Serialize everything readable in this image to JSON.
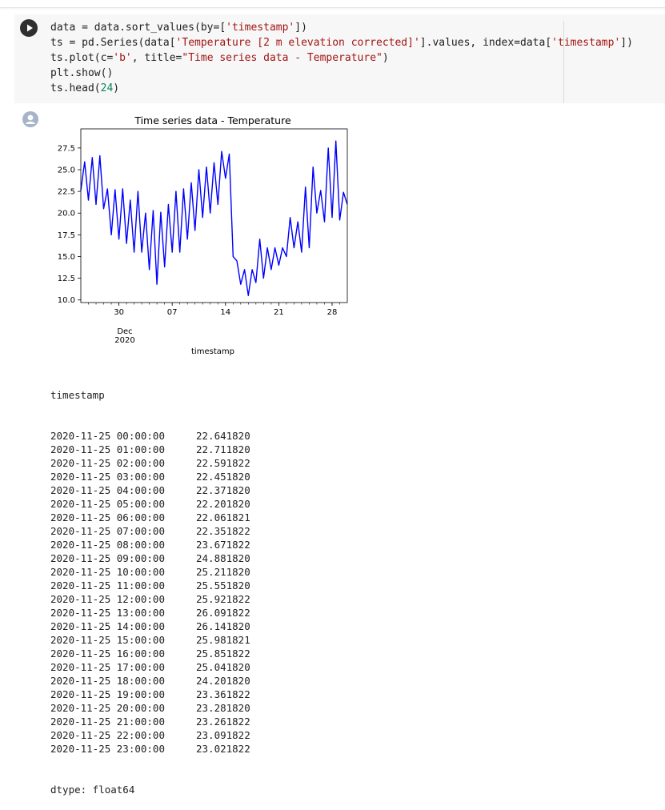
{
  "code_cell": {
    "lines": [
      [
        {
          "t": "data = data.sort_values(by=["
        },
        {
          "t": "'timestamp'",
          "c": "str"
        },
        {
          "t": "])"
        }
      ],
      [
        {
          "t": "ts = pd.Series(data["
        },
        {
          "t": "'Temperature [2 m elevation corrected]'",
          "c": "str"
        },
        {
          "t": "].values, index=data["
        },
        {
          "t": "'timestamp'",
          "c": "str"
        },
        {
          "t": "])"
        }
      ],
      [
        {
          "t": "ts.plot(c="
        },
        {
          "t": "'b'",
          "c": "str"
        },
        {
          "t": ", title="
        },
        {
          "t": "\"Time series data - Temperature\"",
          "c": "str"
        },
        {
          "t": ")"
        }
      ],
      [
        {
          "t": "plt.show()"
        }
      ],
      [
        {
          "t": "ts.head("
        },
        {
          "t": "24",
          "c": "num"
        },
        {
          "t": ")"
        }
      ]
    ]
  },
  "chart_data": {
    "type": "line",
    "title": "Time series data - Temperature",
    "xlabel": "timestamp",
    "ylabel": "",
    "color": "#0000ff",
    "ylim": [
      9.7,
      29.7
    ],
    "yticks": [
      10.0,
      12.5,
      15.0,
      17.5,
      20.0,
      22.5,
      25.0,
      27.5
    ],
    "ytick_labels": [
      "10.0",
      "12.5",
      "15.0",
      "17.5",
      "20.0",
      "22.5",
      "25.0",
      "27.5"
    ],
    "xlim": [
      "2020-11-25",
      "2020-12-30"
    ],
    "xticks": [
      "2020-11-30",
      "2020-12-07",
      "2020-12-14",
      "2020-12-21",
      "2020-12-28"
    ],
    "xtick_labels": [
      "30",
      "07",
      "14",
      "21",
      "28"
    ],
    "x_sublabel": [
      "Dec",
      "2020"
    ],
    "x": [
      "2020-11-25 00:00",
      "2020-11-25 12:00",
      "2020-11-26 00:00",
      "2020-11-26 12:00",
      "2020-11-27 00:00",
      "2020-11-27 12:00",
      "2020-11-28 00:00",
      "2020-11-28 12:00",
      "2020-11-29 00:00",
      "2020-11-29 12:00",
      "2020-11-30 00:00",
      "2020-11-30 12:00",
      "2020-12-01 00:00",
      "2020-12-01 12:00",
      "2020-12-02 00:00",
      "2020-12-02 12:00",
      "2020-12-03 00:00",
      "2020-12-03 12:00",
      "2020-12-04 00:00",
      "2020-12-04 12:00",
      "2020-12-05 00:00",
      "2020-12-05 12:00",
      "2020-12-06 00:00",
      "2020-12-06 12:00",
      "2020-12-07 00:00",
      "2020-12-07 12:00",
      "2020-12-08 00:00",
      "2020-12-08 12:00",
      "2020-12-09 00:00",
      "2020-12-09 12:00",
      "2020-12-10 00:00",
      "2020-12-10 12:00",
      "2020-12-11 00:00",
      "2020-12-11 12:00",
      "2020-12-12 00:00",
      "2020-12-12 12:00",
      "2020-12-13 00:00",
      "2020-12-13 12:00",
      "2020-12-14 00:00",
      "2020-12-14 12:00",
      "2020-12-15 00:00",
      "2020-12-15 12:00",
      "2020-12-16 00:00",
      "2020-12-16 12:00",
      "2020-12-17 00:00",
      "2020-12-17 12:00",
      "2020-12-18 00:00",
      "2020-12-18 12:00",
      "2020-12-19 00:00",
      "2020-12-19 12:00",
      "2020-12-20 00:00",
      "2020-12-20 12:00",
      "2020-12-21 00:00",
      "2020-12-21 12:00",
      "2020-12-22 00:00",
      "2020-12-22 12:00",
      "2020-12-23 00:00",
      "2020-12-23 12:00",
      "2020-12-24 00:00",
      "2020-12-24 12:00",
      "2020-12-25 00:00",
      "2020-12-25 12:00",
      "2020-12-26 00:00",
      "2020-12-26 12:00",
      "2020-12-27 00:00",
      "2020-12-27 12:00",
      "2020-12-28 00:00",
      "2020-12-28 12:00",
      "2020-12-29 00:00",
      "2020-12-29 12:00",
      "2020-12-30 00:00"
    ],
    "values": [
      22.6,
      25.9,
      21.5,
      26.4,
      21.0,
      26.6,
      20.5,
      22.8,
      17.5,
      22.7,
      17.0,
      22.8,
      16.5,
      21.5,
      15.5,
      22.5,
      15.5,
      20.0,
      13.5,
      20.3,
      11.8,
      20.1,
      13.8,
      21.0,
      15.5,
      22.5,
      15.5,
      22.8,
      17.0,
      23.5,
      18.0,
      25.0,
      19.5,
      25.3,
      20.0,
      25.8,
      21.0,
      27.1,
      24.0,
      26.8,
      15.0,
      14.5,
      11.8,
      13.5,
      10.5,
      13.5,
      12.0,
      17.0,
      12.5,
      16.0,
      13.5,
      16.0,
      14.0,
      16.0,
      15.0,
      19.5,
      16.0,
      19.0,
      15.5,
      23.0,
      16.0,
      25.3,
      20.0,
      22.6,
      19.0,
      27.5,
      19.5,
      28.3,
      19.2,
      22.4,
      21.0
    ]
  },
  "output": {
    "index_name": "timestamp",
    "rows": [
      {
        "ts": "2020-11-25 00:00:00",
        "v": "22.641820"
      },
      {
        "ts": "2020-11-25 01:00:00",
        "v": "22.711820"
      },
      {
        "ts": "2020-11-25 02:00:00",
        "v": "22.591822"
      },
      {
        "ts": "2020-11-25 03:00:00",
        "v": "22.451820"
      },
      {
        "ts": "2020-11-25 04:00:00",
        "v": "22.371820"
      },
      {
        "ts": "2020-11-25 05:00:00",
        "v": "22.201820"
      },
      {
        "ts": "2020-11-25 06:00:00",
        "v": "22.061821"
      },
      {
        "ts": "2020-11-25 07:00:00",
        "v": "22.351822"
      },
      {
        "ts": "2020-11-25 08:00:00",
        "v": "23.671822"
      },
      {
        "ts": "2020-11-25 09:00:00",
        "v": "24.881820"
      },
      {
        "ts": "2020-11-25 10:00:00",
        "v": "25.211820"
      },
      {
        "ts": "2020-11-25 11:00:00",
        "v": "25.551820"
      },
      {
        "ts": "2020-11-25 12:00:00",
        "v": "25.921822"
      },
      {
        "ts": "2020-11-25 13:00:00",
        "v": "26.091822"
      },
      {
        "ts": "2020-11-25 14:00:00",
        "v": "26.141820"
      },
      {
        "ts": "2020-11-25 15:00:00",
        "v": "25.981821"
      },
      {
        "ts": "2020-11-25 16:00:00",
        "v": "25.851822"
      },
      {
        "ts": "2020-11-25 17:00:00",
        "v": "25.041820"
      },
      {
        "ts": "2020-11-25 18:00:00",
        "v": "24.201820"
      },
      {
        "ts": "2020-11-25 19:00:00",
        "v": "23.361822"
      },
      {
        "ts": "2020-11-25 20:00:00",
        "v": "23.281820"
      },
      {
        "ts": "2020-11-25 21:00:00",
        "v": "23.261822"
      },
      {
        "ts": "2020-11-25 22:00:00",
        "v": "23.091822"
      },
      {
        "ts": "2020-11-25 23:00:00",
        "v": "23.021822"
      }
    ],
    "dtype": "dtype: float64"
  }
}
